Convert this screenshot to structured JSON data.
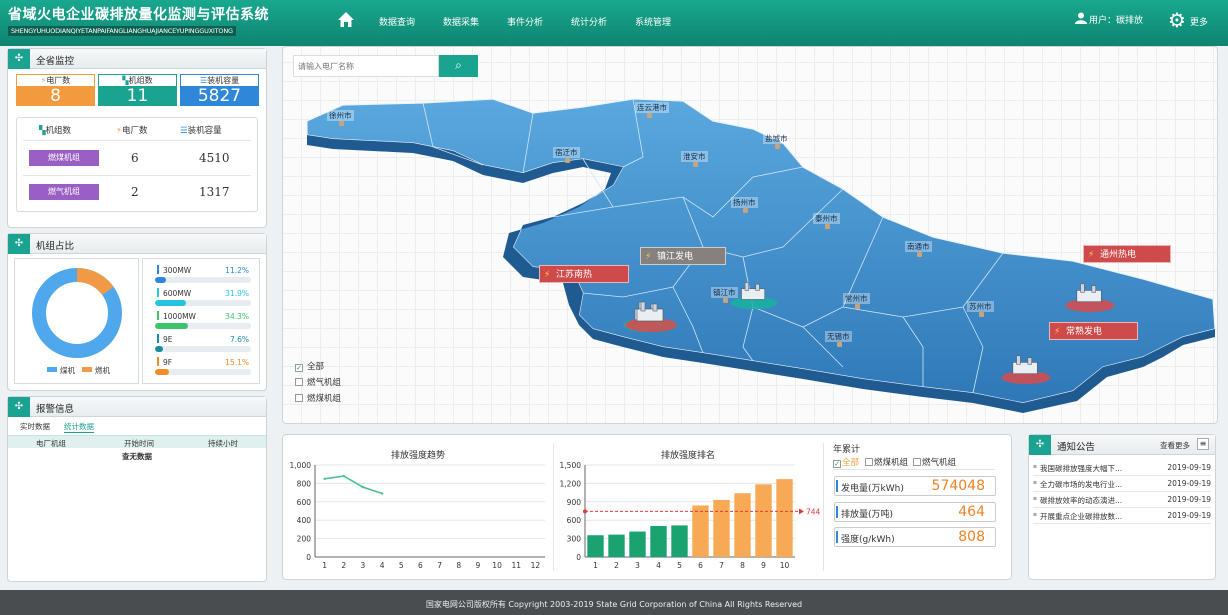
{
  "header": {
    "title": "省域火电企业碳排放量化监测与评估系统",
    "subtitle": "SHENGYUHUODIANQIYETANPAIFANGLIANGHUAJIANCEYUPINGGUXITONG",
    "nav": [
      "数据查询",
      "数据采集",
      "事件分析",
      "统计分析",
      "系统管理"
    ],
    "user": "用户：碳排放",
    "more": "更多"
  },
  "overview": {
    "title": "全省监控",
    "stats": [
      {
        "label": "电厂数",
        "value": "8",
        "color": "#f19a3e"
      },
      {
        "label": "机组数",
        "value": "11",
        "color": "#1aa391"
      },
      {
        "label": "装机容量",
        "value": "5827",
        "color": "#2e87d8"
      }
    ],
    "table_headers": [
      "机组数",
      "电厂数",
      "装机容量"
    ],
    "rows": [
      {
        "type": "燃煤机组",
        "plants": "6",
        "capacity": "4510"
      },
      {
        "type": "燃气机组",
        "plants": "2",
        "capacity": "1317"
      }
    ]
  },
  "ratio": {
    "title": "机组占比",
    "legend": [
      "煤机",
      "燃机"
    ],
    "items": [
      {
        "label": "300MW",
        "pct": "11.2%",
        "value": 0.112,
        "color": "#2e87d8"
      },
      {
        "label": "600MW",
        "pct": "31.9%",
        "value": 0.319,
        "color": "#26c4e0"
      },
      {
        "label": "1000MW",
        "pct": "34.3%",
        "value": 0.343,
        "color": "#3dc46a"
      },
      {
        "label": "9E",
        "pct": "7.6%",
        "value": 0.076,
        "color": "#1a8ba0"
      },
      {
        "label": "9F",
        "pct": "15.1%",
        "value": 0.151,
        "color": "#f08c28"
      }
    ]
  },
  "alarm": {
    "title": "报警信息",
    "tabs": [
      "实时数据",
      "统计数据"
    ],
    "headers": [
      "电厂机组",
      "开始时间",
      "持续小时"
    ],
    "empty": "查无数据"
  },
  "map": {
    "search_placeholder": "请输入电厂名称",
    "cities": [
      "徐州市",
      "连云港市",
      "宿迁市",
      "淮安市",
      "盐城市",
      "扬州市",
      "泰州市",
      "南通市",
      "镇江市",
      "常州市",
      "苏州市",
      "无锡市"
    ],
    "plants": [
      "镇江发电",
      "江苏南热",
      "通州热电",
      "常熟发电"
    ],
    "filters": [
      "全部",
      "燃气机组",
      "燃煤机组"
    ]
  },
  "chart_data": [
    {
      "type": "line",
      "title": "排放强度趋势",
      "xlabel": "",
      "ylabel": "",
      "x": [
        1,
        2,
        3,
        4
      ],
      "values": [
        850,
        880,
        760,
        690
      ],
      "xticks": [
        1,
        2,
        3,
        4,
        5,
        6,
        7,
        8,
        9,
        10,
        11,
        12
      ],
      "ylim": [
        0,
        1000
      ],
      "yticks": [
        "0",
        "200",
        "400",
        "600",
        "800",
        "1,000"
      ],
      "color": "#4fc08d",
      "grid": true
    },
    {
      "type": "bar",
      "title": "排放强度排名",
      "xlabel": "",
      "ylabel": "",
      "categories": [
        "1",
        "2",
        "3",
        "4",
        "5",
        "6",
        "7",
        "8",
        "9",
        "10"
      ],
      "values": [
        355,
        365,
        415,
        505,
        515,
        840,
        930,
        1040,
        1185,
        1270
      ],
      "colors": [
        "#1aa371",
        "#1aa371",
        "#1aa371",
        "#1aa371",
        "#1aa371",
        "#f7a956",
        "#f7a956",
        "#f7a956",
        "#f7a956",
        "#f7a956"
      ],
      "ylim": [
        0,
        1500
      ],
      "yticks": [
        "0",
        "300",
        "600",
        "900",
        "1,200",
        "1,500"
      ],
      "reference": 744,
      "reference_label": "744",
      "grid": true
    }
  ],
  "annual": {
    "title": "年累计",
    "filters": [
      "全部",
      "燃煤机组",
      "燃气机组"
    ],
    "items": [
      {
        "label": "发电量(万kWh)",
        "value": "574048"
      },
      {
        "label": "排放量(万吨)",
        "value": "464"
      },
      {
        "label": "强度(g/kWh)",
        "value": "808"
      }
    ]
  },
  "notice": {
    "title": "通知公告",
    "more": "查看更多",
    "items": [
      {
        "text": "我国碳排放强度大幅下...",
        "date": "2019-09-19"
      },
      {
        "text": "全力碳市场的发电行业...",
        "date": "2019-09-19"
      },
      {
        "text": "碳排放效率的动态演进...",
        "date": "2019-09-19"
      },
      {
        "text": "开展重点企业碳排放数...",
        "date": "2019-09-19"
      }
    ]
  },
  "footer": "国家电网公司版权所有 Copyright 2003-2019 State Grid Corporation of China All Rights Reserved"
}
